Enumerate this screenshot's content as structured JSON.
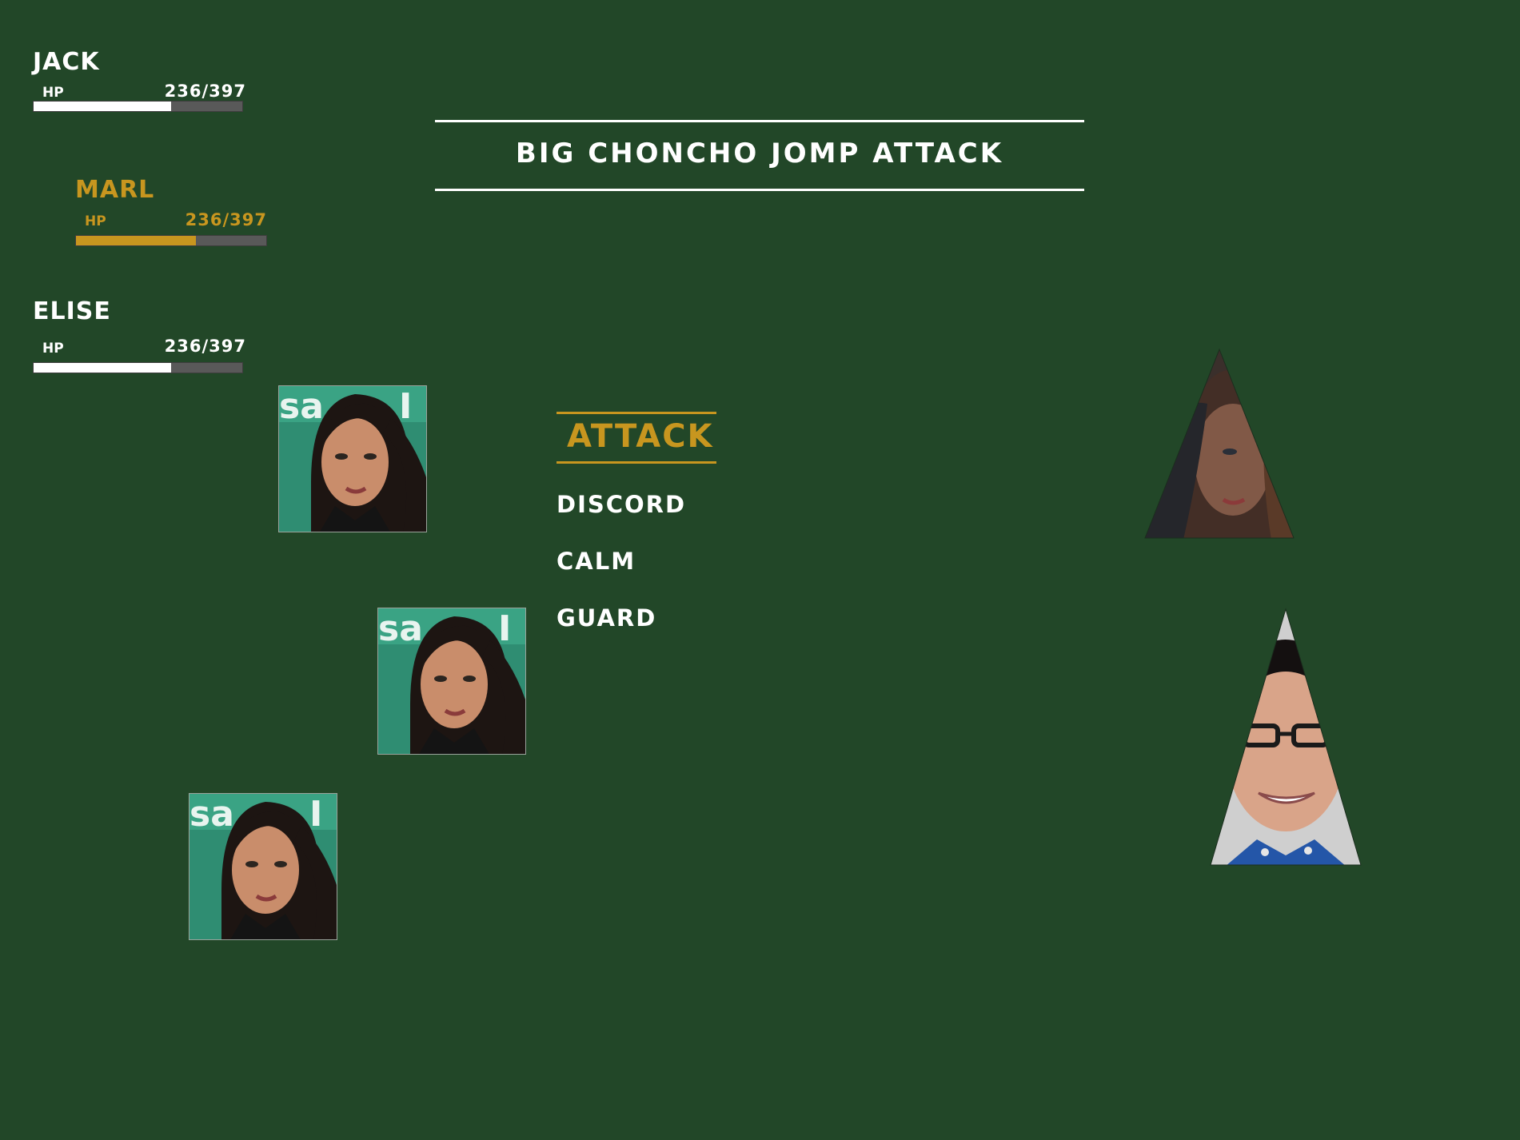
{
  "party": [
    {
      "name": "JACK",
      "hp_label": "HP",
      "hp_text": "236/397",
      "hp_fraction": 0.66,
      "active": false
    },
    {
      "name": "MARL",
      "hp_label": "HP",
      "hp_text": "236/397",
      "hp_fraction": 0.63,
      "active": true
    },
    {
      "name": "ELISE",
      "hp_label": "HP",
      "hp_text": "236/397",
      "hp_fraction": 0.66,
      "active": false
    }
  ],
  "banner": {
    "title": "BIG CHONCHO JOMP ATTACK"
  },
  "commands": [
    {
      "label": "ATTACK",
      "selected": true
    },
    {
      "label": "DISCORD",
      "selected": false
    },
    {
      "label": "CALM",
      "selected": false
    },
    {
      "label": "GUARD",
      "selected": false
    }
  ],
  "portraits": [
    {
      "icon": "party-member-portrait"
    },
    {
      "icon": "party-member-portrait"
    },
    {
      "icon": "party-member-portrait"
    }
  ],
  "enemies": [
    {
      "icon": "enemy-triangle-portrait-woman"
    },
    {
      "icon": "enemy-triangle-portrait-man-glasses"
    }
  ],
  "colors": {
    "background": "#224728",
    "text": "#ffffff",
    "accent": "#c8961f",
    "hp_track": "#595959"
  }
}
